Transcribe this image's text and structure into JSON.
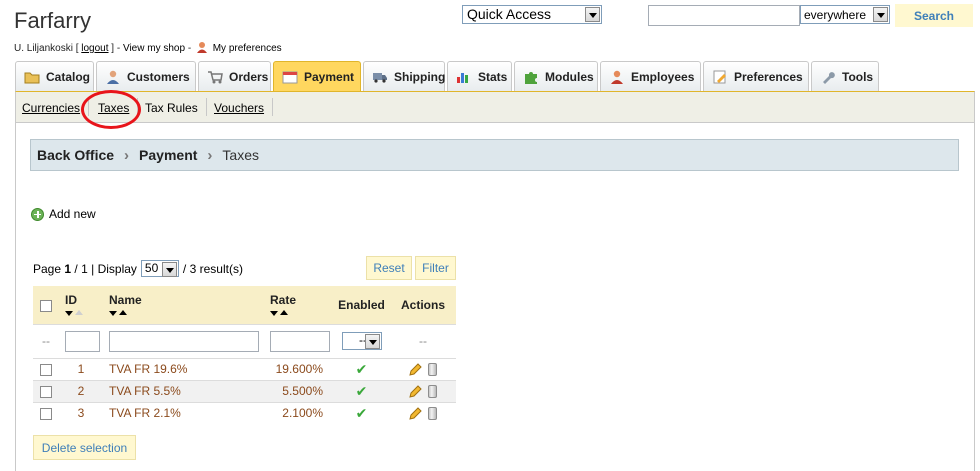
{
  "header": {
    "shop_name": "Farfarry",
    "user_name": "U. Liljankoski",
    "logout_label": "logout",
    "view_shop_label": "View my shop",
    "preferences_label": "My preferences",
    "quick_access": "Quick Access",
    "search_value": "",
    "search_scope": "everywhere",
    "search_button": "Search"
  },
  "tabs": [
    {
      "label": "Catalog",
      "icon": "folder-icon"
    },
    {
      "label": "Customers",
      "icon": "customer-icon"
    },
    {
      "label": "Orders",
      "icon": "cart-icon"
    },
    {
      "label": "Payment",
      "icon": "payment-icon",
      "active": true
    },
    {
      "label": "Shipping",
      "icon": "truck-icon"
    },
    {
      "label": "Stats",
      "icon": "chart-icon"
    },
    {
      "label": "Modules",
      "icon": "puzzle-icon"
    },
    {
      "label": "Employees",
      "icon": "employee-icon"
    },
    {
      "label": "Preferences",
      "icon": "preferences-icon"
    },
    {
      "label": "Tools",
      "icon": "wrench-icon"
    }
  ],
  "subnav": [
    "Currencies",
    "Taxes",
    "Tax Rules",
    "Vouchers"
  ],
  "breadcrumb": [
    "Back Office",
    "Payment",
    "Taxes"
  ],
  "add_new_label": "Add new",
  "pagination": {
    "page_word": "Page",
    "current": "1",
    "total": "1",
    "display_word": "Display",
    "per_page": "50",
    "results": "/ 3 result(s)"
  },
  "buttons": {
    "reset": "Reset",
    "filter": "Filter",
    "delete_selection": "Delete selection"
  },
  "table": {
    "columns": [
      "ID",
      "Name",
      "Rate",
      "Enabled",
      "Actions"
    ],
    "filter_enabled_value": "--",
    "filter_placeholder": "--",
    "rows": [
      {
        "id": "1",
        "name": "TVA FR 19.6%",
        "rate": "19.600%"
      },
      {
        "id": "2",
        "name": "TVA FR 5.5%",
        "rate": "5.500%"
      },
      {
        "id": "3",
        "name": "TVA FR 2.1%",
        "rate": "2.100%"
      }
    ],
    "highlight_color": "#e8141a"
  }
}
